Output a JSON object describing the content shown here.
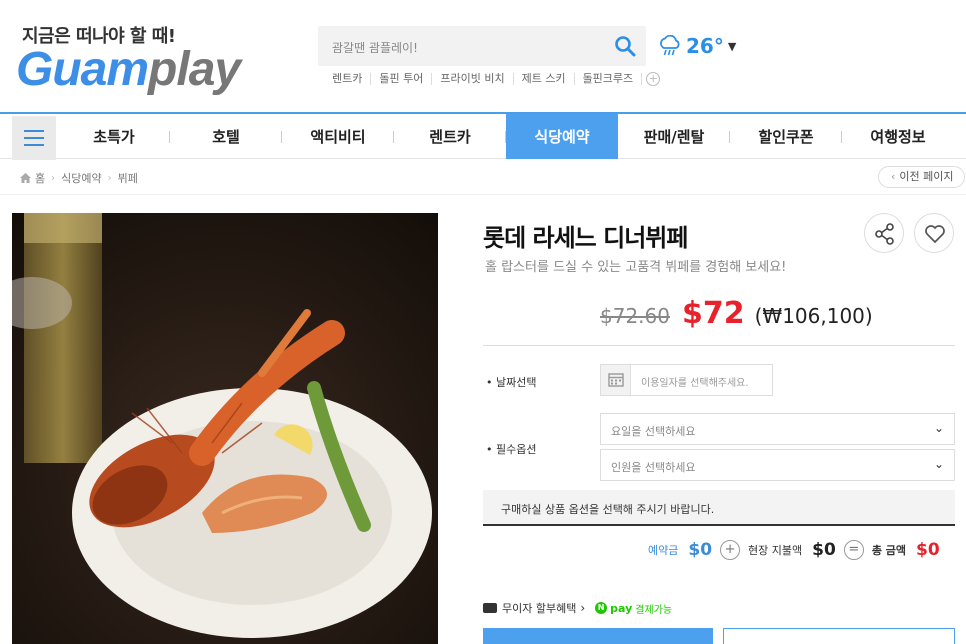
{
  "header": {
    "slogan": "지금은 떠나야 할 때!",
    "brand_part1": "Guam",
    "brand_part2": "play",
    "search_placeholder": "괌갈땐 괌플레이!",
    "quick_links": [
      "렌트카",
      "돌핀 투어",
      "프라이빗 비치",
      "제트 스키",
      "돌핀크루즈"
    ],
    "weather_temp": "26°"
  },
  "nav": {
    "items": [
      "초특가",
      "호텔",
      "액티비티",
      "렌트카",
      "식당예약",
      "판매/렌탈",
      "할인쿠폰",
      "여행정보"
    ],
    "active": "식당예약"
  },
  "breadcrumb": [
    "홈",
    "식당예약",
    "뷔페"
  ],
  "back_label": "이전 페이지",
  "product": {
    "title": "롯데 라세느 디너뷔페",
    "subtitle": "홀 랍스터를 드실 수 있는 고품격 뷔페를 경험해 보세요!",
    "old_price": "$72.60",
    "price": "$72",
    "krw_price": "(₩106,100)"
  },
  "options": {
    "date_label": "• 날짜선택",
    "date_placeholder": "이용일자를 선택해주세요.",
    "required_label": "• 필수옵션",
    "select_day": "요일을 선택하세요",
    "select_people": "인원을 선택하세요",
    "notice": "구매하실 상품 옵션을 선택해 주시기 바랍니다."
  },
  "totals": {
    "deposit_label": "예약금",
    "deposit_value": "$0",
    "onsite_label": "현장 지불액",
    "onsite_value": "$0",
    "total_label": "총 금액",
    "total_value": "$0"
  },
  "benefit": {
    "installment": "무이자 할부혜택",
    "npay": "pay",
    "npay_note": "결제가능"
  },
  "colors": {
    "accent": "#4da0ee",
    "price_red": "#e8222a",
    "npay_green": "#1ec800"
  }
}
